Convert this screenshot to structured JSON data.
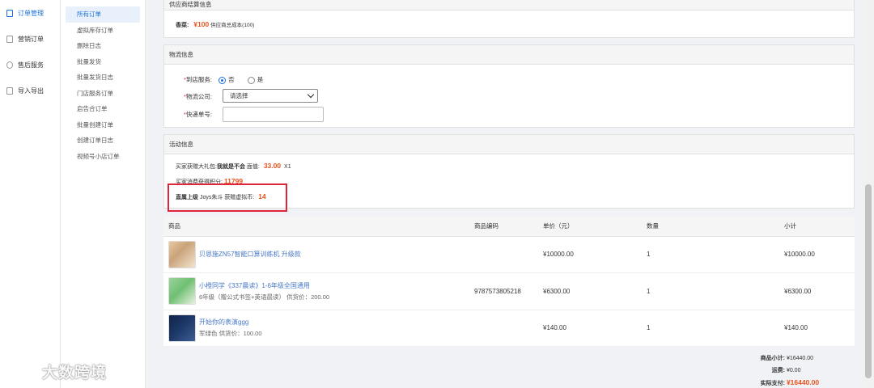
{
  "sidebar": {
    "items": [
      {
        "label": "订单管理",
        "icon": "order-icon"
      },
      {
        "label": "营销订单",
        "icon": "marketing-icon"
      },
      {
        "label": "售后服务",
        "icon": "service-icon"
      },
      {
        "label": "导入导出",
        "icon": "import-export-icon"
      }
    ]
  },
  "subnav": {
    "items": [
      "所有订单",
      "虚拟库存订单",
      "删除日志",
      "批量发货",
      "批量发货日志",
      "门店服务订单",
      "启告合订单",
      "批量创建订单",
      "创建订单日志",
      "视频号小店订单"
    ]
  },
  "settlement": {
    "title": "供应商结算信息",
    "supplier_label": "香菜:",
    "amount": "¥100",
    "note": "供应商总成本(100)"
  },
  "logistics": {
    "title": "物流信息",
    "store_service_label": "到店服务:",
    "option_no": "否",
    "option_yes": "是",
    "company_label": "物流公司:",
    "company_placeholder": "请选择",
    "tracking_label": "快递单号:",
    "required_mark": "*"
  },
  "activity": {
    "title": "活动信息",
    "line1_prefix": "买家获赠大礼包:",
    "line1_name": "我就是不会",
    "line1_value_label": "面值:",
    "line1_value": "33.00",
    "line1_qty": "X1",
    "line2_prefix": "买家消费获得积分:",
    "line2_value": "11799",
    "line3_prefix": "直属上级",
    "line3_name": "Joys朱斗",
    "line3_mid": "获赠虚拟币:",
    "line3_value": "14"
  },
  "goods_table": {
    "headers": [
      "商品",
      "商品编码",
      "单价（元）",
      "数量",
      "小计"
    ],
    "rows": [
      {
        "name": "贝恩施ZN57智能口算训练机 升级款",
        "sub": "",
        "code": "",
        "price": "¥10000.00",
        "qty": "1",
        "subtotal": "¥10000.00",
        "thumb_color": "#c9a37a"
      },
      {
        "name": "小橙同学《337晨读》1-6年级全国通用",
        "sub": "6年级（赠公式书签+英语晨读） 供货价：200.00",
        "code": "9787573805218",
        "price": "¥6300.00",
        "qty": "1",
        "subtotal": "¥6300.00",
        "thumb_color": "#6fbf73"
      },
      {
        "name": "开始你的表演ggg",
        "sub": "军绿色 供货价：100.00",
        "code": "",
        "price": "¥140.00",
        "qty": "1",
        "subtotal": "¥140.00",
        "thumb_color": "#1e3a6b"
      }
    ]
  },
  "summary": {
    "subtotal_label": "商品小计:",
    "subtotal_value": "¥16440.00",
    "shipping_label": "运费:",
    "shipping_value": "¥0.00",
    "paid_label": "实际支付:",
    "paid_value": "¥16440.00"
  },
  "watermark": {
    "text": "大数跨境"
  },
  "colors": {
    "accent": "#1a6fd8",
    "price": "#e8541e",
    "highlight_box": "#e0243a"
  }
}
